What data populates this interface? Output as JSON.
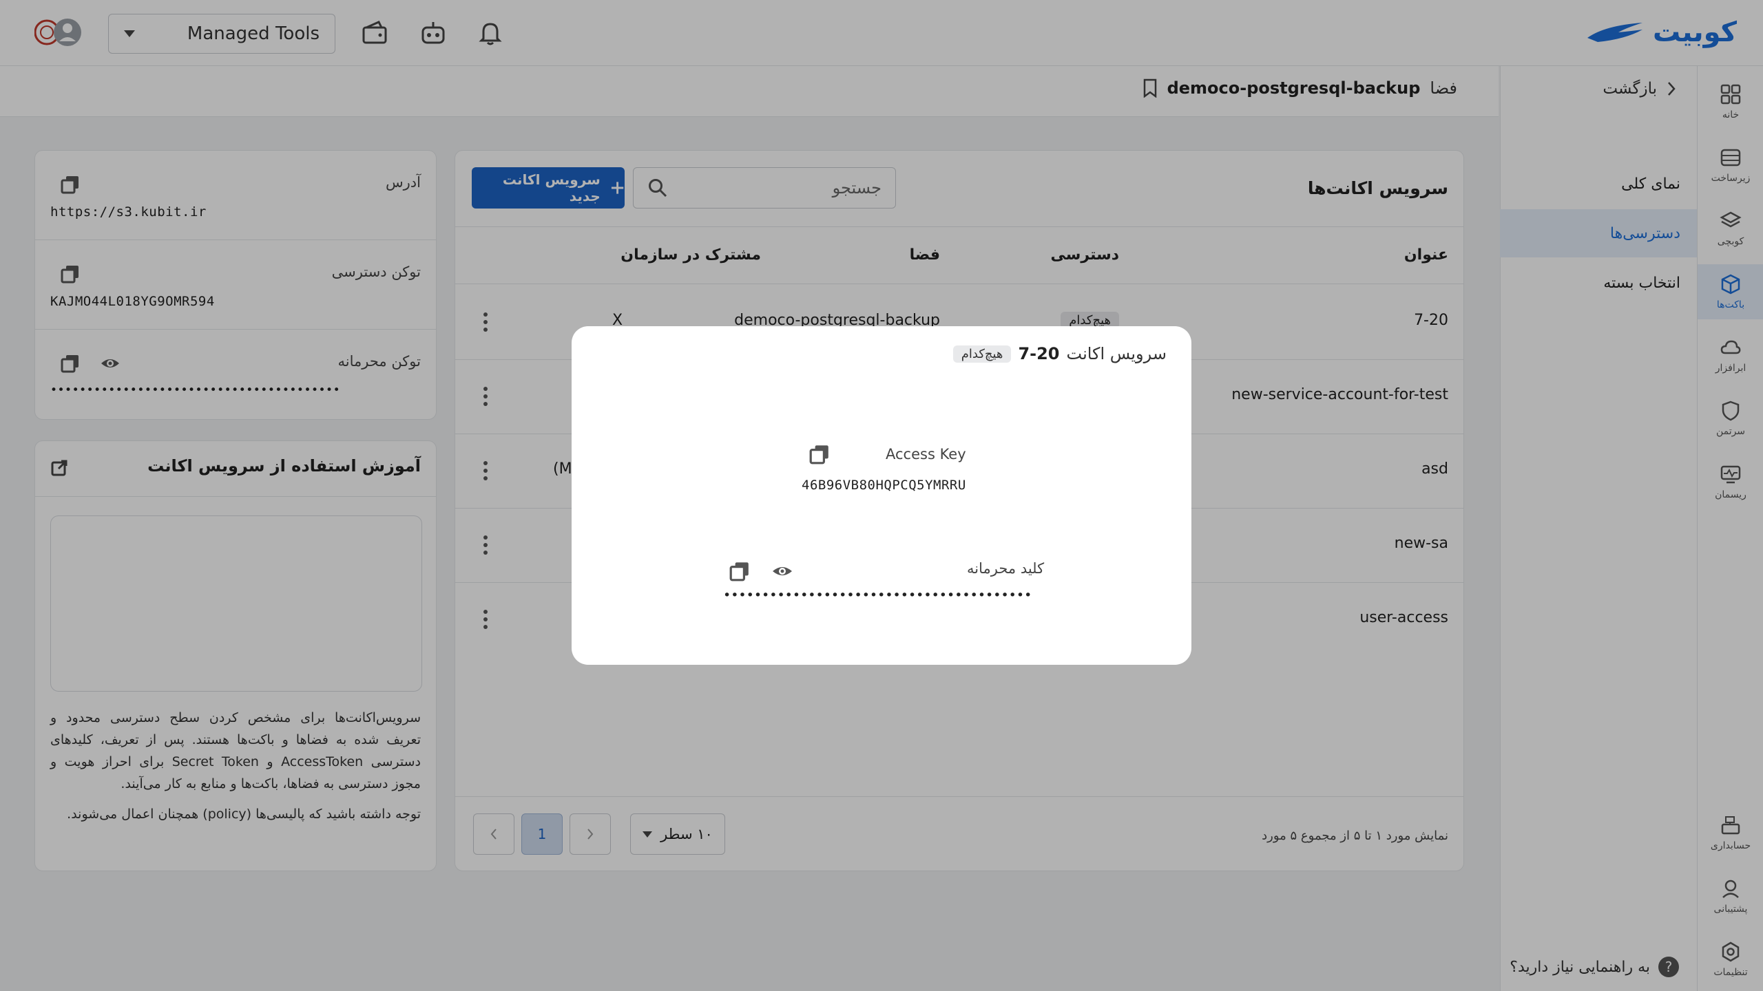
{
  "header": {
    "logo_text": "کوبیت",
    "project_select": "Managed Tools"
  },
  "rail": {
    "items": [
      {
        "label": "خانه"
      },
      {
        "label": "زیرساخت"
      },
      {
        "label": "کوبچی"
      },
      {
        "label": "باکت‌ها"
      },
      {
        "label": "ابرافزار"
      },
      {
        "label": "سرتمن"
      },
      {
        "label": "ریسمان"
      },
      {
        "label": "حسابداری"
      },
      {
        "label": "پشتیبانی"
      },
      {
        "label": "تنظیمات"
      }
    ]
  },
  "sidebar": {
    "back": "بازگشت",
    "items": [
      {
        "label": "نمای کلی"
      },
      {
        "label": "دسترسی‌ها"
      },
      {
        "label": "انتخاب بسته"
      }
    ],
    "help": "به راهنمایی نیاز دارید؟"
  },
  "breadcrumb": {
    "space_word": "فضا",
    "bucket": "democo-postgresql-backup"
  },
  "main": {
    "title": "سرویس اکانت‌ها",
    "search_placeholder": "جستجو",
    "new_button": "سرویس اکانت جدید",
    "columns": {
      "title": "عنوان",
      "access": "دسترسی",
      "space": "فضا",
      "shared": "مشترک در سازمان"
    },
    "rows": [
      {
        "title": "7-20",
        "access": "هیچ‌کدام",
        "space": "democo-postgresql-backup",
        "shared": "X"
      },
      {
        "title": "new-service-account-for-test"
      },
      {
        "title": "asd",
        "shared": "(M"
      },
      {
        "title": "new-sa"
      },
      {
        "title": "user-access"
      }
    ],
    "page_info": "نمایش مورد ۱ تا ۵ از مجموع ۵ مورد",
    "rows_per_page": "۱۰ سطر",
    "current_page": "1"
  },
  "info": {
    "address_label": "آدرس",
    "address_value": "https://s3.kubit.ir",
    "access_token_label": "توکن دسترسی",
    "access_token_value": "KAJMO44L018YG9OMR594",
    "secret_token_label": "توکن محرمانه",
    "secret_token_value": "••••••••••••••••••••••••••••••••••••••••"
  },
  "guide": {
    "title": "آموزش استفاده از سرویس اکانت",
    "p1": "سرویس‌اکانت‌ها برای مشخص کردن سطح دسترسی محدود و تعریف شده به فضاها و باکت‌ها هستند. پس از تعریف، کلیدهای دسترسی AccessToken و Secret Token برای احراز هویت و مجوز دسترسی به فضاها، باکت‌ها و منابع به کار می‌آیند.",
    "p2": "توجه داشته باشید که پالیسی‌ها (policy) همچنان اعمال می‌شوند."
  },
  "modal": {
    "prefix": "سرویس اکانت",
    "name": "7-20",
    "badge": "هیچ‌کدام",
    "access_key_label": "Access Key",
    "access_key_value": "46B96VB80HQPCQ5YMRRU",
    "secret_key_label": "کلید محرمانه",
    "secret_key_value": "••••••••••••••••••••••••••••••••••••••••"
  }
}
